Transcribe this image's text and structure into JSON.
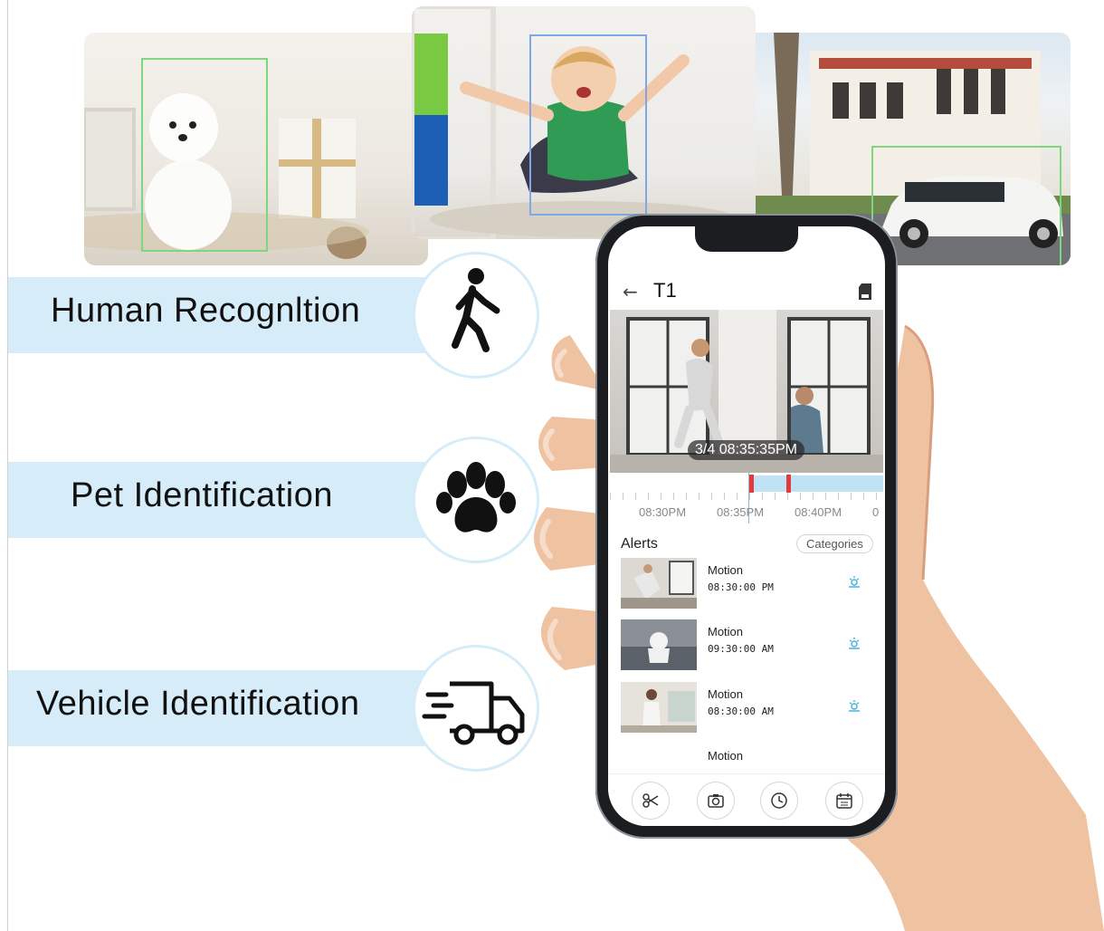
{
  "features": [
    {
      "label": "Human Recognltion",
      "icon": "walking-person-icon"
    },
    {
      "label": "Pet Identification",
      "icon": "paw-icon"
    },
    {
      "label": "Vehicle Identification",
      "icon": "delivery-truck-icon"
    }
  ],
  "phone": {
    "title": "T1",
    "back_icon": "back-arrow-icon",
    "storage_icon": "sd-card-icon",
    "video_timestamp": "3/4 08:35:35PM",
    "timeline_labels": [
      "08:30PM",
      "08:35PM",
      "08:40PM",
      "0"
    ],
    "alerts_heading": "Alerts",
    "categories_button": "Categories",
    "alerts": [
      {
        "type": "Motion",
        "time": "08:30:00 PM"
      },
      {
        "type": "Motion",
        "time": "09:30:00 AM"
      },
      {
        "type": "Motion",
        "time": "08:30:00 AM"
      },
      {
        "type": "Motion",
        "time": ""
      }
    ],
    "bottom_buttons": [
      "scissors-icon",
      "camera-icon",
      "clock-icon",
      "calendar-icon"
    ]
  },
  "colors": {
    "band": "#d6ecf8",
    "accent_blue": "#4ab3e0",
    "bbox_green": "#7fd67f",
    "bbox_blue": "#7fa6e8",
    "marker_red": "#e23b3b"
  }
}
